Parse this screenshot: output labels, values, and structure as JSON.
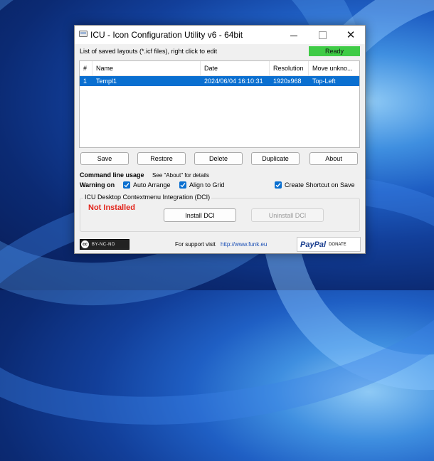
{
  "window": {
    "title": "ICU - Icon Configuration Utility v6 - 64bit"
  },
  "header": {
    "saved_layouts_label": "List of saved layouts (*.icf files), right click to edit",
    "status": "Ready",
    "status_color": "#3fcb46"
  },
  "list": {
    "columns": [
      "#",
      "Name",
      "Date",
      "Resolution",
      "Move unkno..."
    ],
    "rows": [
      {
        "index": "1",
        "name": "Templ1",
        "date": "2024/06/04 16:10:31",
        "resolution": "1920x968",
        "move": "Top-Left"
      }
    ],
    "selected_color": "#0a6fd0"
  },
  "buttons": {
    "save": "Save",
    "restore": "Restore",
    "delete": "Delete",
    "duplicate": "Duplicate",
    "about": "About"
  },
  "options": {
    "cmd_label": "Command line usage",
    "cmd_note": "See \"About\" for details",
    "warning_label": "Warning on",
    "auto_arrange": {
      "label": "Auto Arrange",
      "checked": true
    },
    "align_grid": {
      "label": "Align to Grid",
      "checked": true
    },
    "create_shortcut": {
      "label": "Create Shortcut on Save",
      "checked": true
    }
  },
  "dci": {
    "group_title": "ICU Desktop Contextmenu Integration (DCI)",
    "status": "Not Installed",
    "status_color": "#e2231a",
    "install": "Install DCI",
    "uninstall": "Uninstall DCI"
  },
  "footer": {
    "cc_symbol": "cc",
    "license": "BY-NC-ND",
    "support_text": "For support visit",
    "support_link": "http://www.funk.eu",
    "paypal_logo": "PayPal",
    "donate": "DONATE"
  }
}
